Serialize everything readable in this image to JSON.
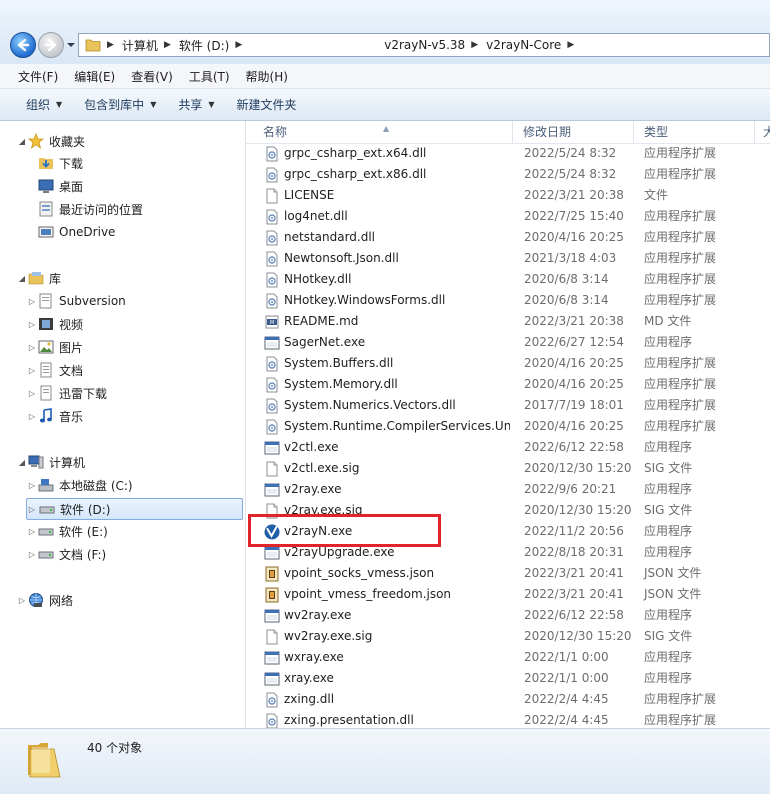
{
  "address_bar": {
    "crumbs": [
      "计算机",
      "软件 (D:)",
      "v2rayN-v5.38",
      "v2rayN-Core"
    ]
  },
  "menu": [
    "文件(F)",
    "编辑(E)",
    "查看(V)",
    "工具(T)",
    "帮助(H)"
  ],
  "toolbar": {
    "organize": "组织",
    "include_library": "包含到库中",
    "share": "共享",
    "new_folder": "新建文件夹"
  },
  "nav": {
    "favorites": "收藏夹",
    "downloads": "下载",
    "desktop": "桌面",
    "recent": "最近访问的位置",
    "onedrive": "OneDrive",
    "libraries": "库",
    "subversion": "Subversion",
    "videos": "视频",
    "pictures": "图片",
    "documents": "文档",
    "xunlei": "迅雷下载",
    "music": "音乐",
    "computer": "计算机",
    "drive_c": "本地磁盘 (C:)",
    "drive_d": "软件 (D:)",
    "drive_e": "软件 (E:)",
    "drive_f": "文档 (F:)",
    "network": "网络"
  },
  "columns": {
    "name": "名称",
    "date": "修改日期",
    "type": "类型",
    "size": "大"
  },
  "files": [
    {
      "name": "grpc_csharp_ext.x64.dll",
      "date": "2022/5/24 8:32",
      "type": "应用程序扩展",
      "icon": "dll-icon"
    },
    {
      "name": "grpc_csharp_ext.x86.dll",
      "date": "2022/5/24 8:32",
      "type": "应用程序扩展",
      "icon": "dll-icon"
    },
    {
      "name": "LICENSE",
      "date": "2022/3/21 20:38",
      "type": "文件",
      "icon": "blank-file-icon"
    },
    {
      "name": "log4net.dll",
      "date": "2022/7/25 15:40",
      "type": "应用程序扩展",
      "icon": "dll-icon"
    },
    {
      "name": "netstandard.dll",
      "date": "2020/4/16 20:25",
      "type": "应用程序扩展",
      "icon": "dll-icon"
    },
    {
      "name": "Newtonsoft.Json.dll",
      "date": "2021/3/18 4:03",
      "type": "应用程序扩展",
      "icon": "dll-icon"
    },
    {
      "name": "NHotkey.dll",
      "date": "2020/6/8 3:14",
      "type": "应用程序扩展",
      "icon": "dll-icon"
    },
    {
      "name": "NHotkey.WindowsForms.dll",
      "date": "2020/6/8 3:14",
      "type": "应用程序扩展",
      "icon": "dll-icon"
    },
    {
      "name": "README.md",
      "date": "2022/3/21 20:38",
      "type": "MD 文件",
      "icon": "md-file-icon"
    },
    {
      "name": "SagerNet.exe",
      "date": "2022/6/27 12:54",
      "type": "应用程序",
      "icon": "exe-icon"
    },
    {
      "name": "System.Buffers.dll",
      "date": "2020/4/16 20:25",
      "type": "应用程序扩展",
      "icon": "dll-icon"
    },
    {
      "name": "System.Memory.dll",
      "date": "2020/4/16 20:25",
      "type": "应用程序扩展",
      "icon": "dll-icon"
    },
    {
      "name": "System.Numerics.Vectors.dll",
      "date": "2017/7/19 18:01",
      "type": "应用程序扩展",
      "icon": "dll-icon"
    },
    {
      "name": "System.Runtime.CompilerServices.Un...",
      "date": "2020/4/16 20:25",
      "type": "应用程序扩展",
      "icon": "dll-icon"
    },
    {
      "name": "v2ctl.exe",
      "date": "2022/6/12 22:58",
      "type": "应用程序",
      "icon": "exe-icon"
    },
    {
      "name": "v2ctl.exe.sig",
      "date": "2020/12/30 15:20",
      "type": "SIG 文件",
      "icon": "blank-file-icon"
    },
    {
      "name": "v2ray.exe",
      "date": "2022/9/6 20:21",
      "type": "应用程序",
      "icon": "exe-icon"
    },
    {
      "name": "v2ray.exe.sig",
      "date": "2020/12/30 15:20",
      "type": "SIG 文件",
      "icon": "blank-file-icon"
    },
    {
      "name": "v2rayN.exe",
      "date": "2022/11/2 20:56",
      "type": "应用程序",
      "icon": "v2rayn-icon"
    },
    {
      "name": "v2rayUpgrade.exe",
      "date": "2022/8/18 20:31",
      "type": "应用程序",
      "icon": "exe-icon"
    },
    {
      "name": "vpoint_socks_vmess.json",
      "date": "2022/3/21 20:41",
      "type": "JSON 文件",
      "icon": "json-file-icon"
    },
    {
      "name": "vpoint_vmess_freedom.json",
      "date": "2022/3/21 20:41",
      "type": "JSON 文件",
      "icon": "json-file-icon"
    },
    {
      "name": "wv2ray.exe",
      "date": "2022/6/12 22:58",
      "type": "应用程序",
      "icon": "exe-icon"
    },
    {
      "name": "wv2ray.exe.sig",
      "date": "2020/12/30 15:20",
      "type": "SIG 文件",
      "icon": "blank-file-icon"
    },
    {
      "name": "wxray.exe",
      "date": "2022/1/1 0:00",
      "type": "应用程序",
      "icon": "exe-icon"
    },
    {
      "name": "xray.exe",
      "date": "2022/1/1 0:00",
      "type": "应用程序",
      "icon": "exe-icon"
    },
    {
      "name": "zxing.dll",
      "date": "2022/2/4 4:45",
      "type": "应用程序扩展",
      "icon": "dll-icon"
    },
    {
      "name": "zxing.presentation.dll",
      "date": "2022/2/4 4:45",
      "type": "应用程序扩展",
      "icon": "dll-icon"
    }
  ],
  "status": {
    "item_count": "40 个对象"
  },
  "colors": {
    "highlight": "#e2242a",
    "accent": "#1f6bd1"
  }
}
